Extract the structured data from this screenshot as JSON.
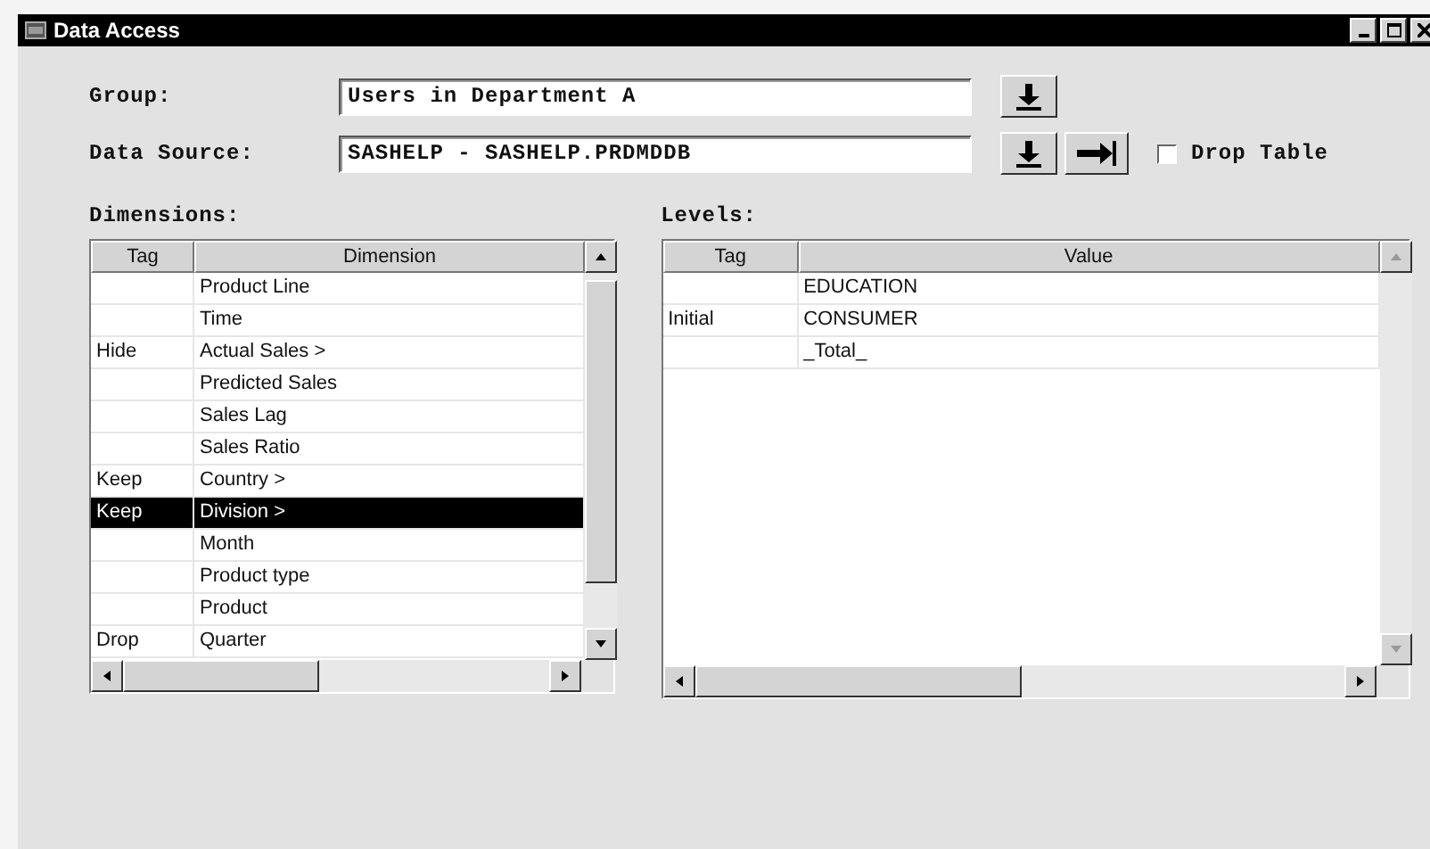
{
  "window": {
    "title": "Data Access"
  },
  "form": {
    "group_label": "Group:",
    "group_value": "Users in Department A",
    "source_label": "Data Source:",
    "source_value": "SASHELP - SASHELP.PRDMDDB",
    "drop_table": {
      "label": "Drop Table",
      "checked": false
    }
  },
  "dimensions": {
    "title": "Dimensions:",
    "columns": [
      "Tag",
      "Dimension"
    ],
    "rows": [
      {
        "tag": "",
        "name": "Product Line",
        "selected": false
      },
      {
        "tag": "",
        "name": "Time",
        "selected": false
      },
      {
        "tag": "Hide",
        "name": "Actual Sales >",
        "selected": false
      },
      {
        "tag": "",
        "name": "Predicted Sales",
        "selected": false
      },
      {
        "tag": "",
        "name": "Sales Lag",
        "selected": false
      },
      {
        "tag": "",
        "name": "Sales Ratio",
        "selected": false
      },
      {
        "tag": "Keep",
        "name": "Country >",
        "selected": false
      },
      {
        "tag": "Keep",
        "name": "Division >",
        "selected": true
      },
      {
        "tag": "",
        "name": "Month",
        "selected": false
      },
      {
        "tag": "",
        "name": "Product type",
        "selected": false
      },
      {
        "tag": "",
        "name": "Product",
        "selected": false
      },
      {
        "tag": "Drop",
        "name": "Quarter",
        "selected": false
      }
    ]
  },
  "levels": {
    "title": "Levels:",
    "columns": [
      "Tag",
      "Value"
    ],
    "rows": [
      {
        "tag": "",
        "name": "EDUCATION",
        "selected": false
      },
      {
        "tag": "Initial",
        "name": "CONSUMER",
        "selected": false
      },
      {
        "tag": "",
        "name": "_Total_",
        "selected": false
      }
    ]
  }
}
